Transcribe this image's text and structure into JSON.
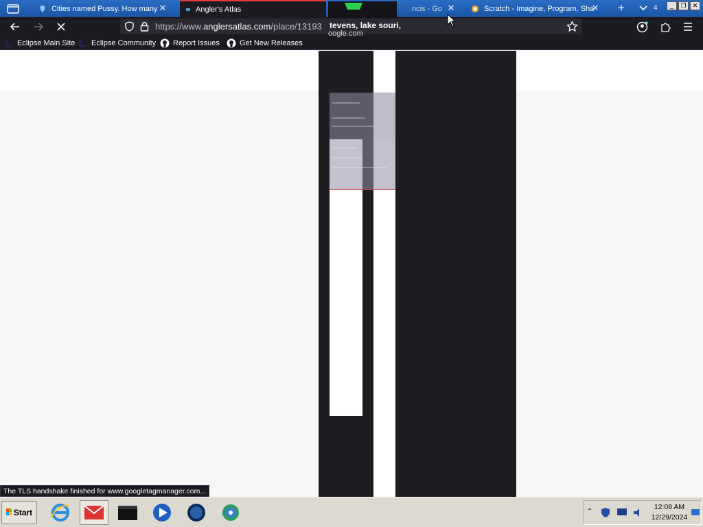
{
  "browser": {
    "tabs": [
      {
        "title": "Cities named Pussy. How many",
        "icon": "map-pin-icon"
      },
      {
        "title": "Angler's Atlas",
        "icon": "anglers-atlas-icon",
        "active": true,
        "loading": true
      },
      {
        "title": "ncis - Go",
        "icon": "google-icon"
      },
      {
        "title": "Scratch - Imagine, Program, Sha",
        "icon": "scratch-icon"
      }
    ],
    "tab_count": "4",
    "url": {
      "prefix": "https://www.",
      "host": "anglersatlas.com",
      "path": "/place/13193"
    },
    "suggestion_fragment": {
      "title": "tevens, lake souri,",
      "subtitle": "oogle.com"
    },
    "bookmarks": [
      {
        "label": "Eclipse Main Site",
        "icon": "eclipse-icon"
      },
      {
        "label": "Eclipse Community",
        "icon": "eclipse-icon"
      },
      {
        "label": "Report Issues",
        "icon": "github-icon"
      },
      {
        "label": "Get New Releases",
        "icon": "github-icon"
      }
    ],
    "status_text": "The TLS handshake finished for www.googletagmanager.com..."
  },
  "taskbar": {
    "start_label": "Start",
    "apps": [
      "internet-explorer-icon",
      "gmail-icon",
      "terminal-icon",
      "media-player-icon",
      "globe-icon",
      "network-icon"
    ],
    "clock": {
      "time": "12:08 AM",
      "date": "12/29/2024"
    }
  },
  "colors": {
    "tabstrip": "#1d5fb5",
    "chrome_dark": "#1c1b22",
    "urlbar": "#2b2a33",
    "page_bg": "#f7f7f7",
    "dark_column": "#1e1e22",
    "taskbar": "#dcd9d1"
  }
}
